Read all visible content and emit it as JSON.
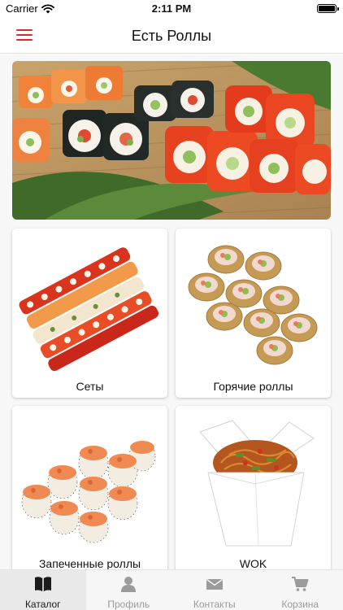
{
  "status_bar": {
    "carrier": "Carrier",
    "time": "2:11 PM"
  },
  "nav": {
    "title": "Есть Роллы",
    "menu_icon": "hamburger-menu-icon"
  },
  "banner": {
    "description_icon": "sushi-rolls-banner"
  },
  "categories": [
    {
      "label": "Сеты"
    },
    {
      "label": "Горячие роллы"
    },
    {
      "label": "Запеченные роллы"
    },
    {
      "label": "WOK"
    }
  ],
  "tab_bar": {
    "items": [
      {
        "label": "Каталог",
        "icon": "book-icon",
        "active": true
      },
      {
        "label": "Профиль",
        "icon": "person-icon",
        "active": false
      },
      {
        "label": "Контакты",
        "icon": "envelope-icon",
        "active": false
      },
      {
        "label": "Корзина",
        "icon": "cart-icon",
        "active": false
      }
    ]
  },
  "colors": {
    "accent": "#d62b36",
    "tab_active": "#1b1b1b",
    "tab_inactive": "#9b9b9b"
  }
}
